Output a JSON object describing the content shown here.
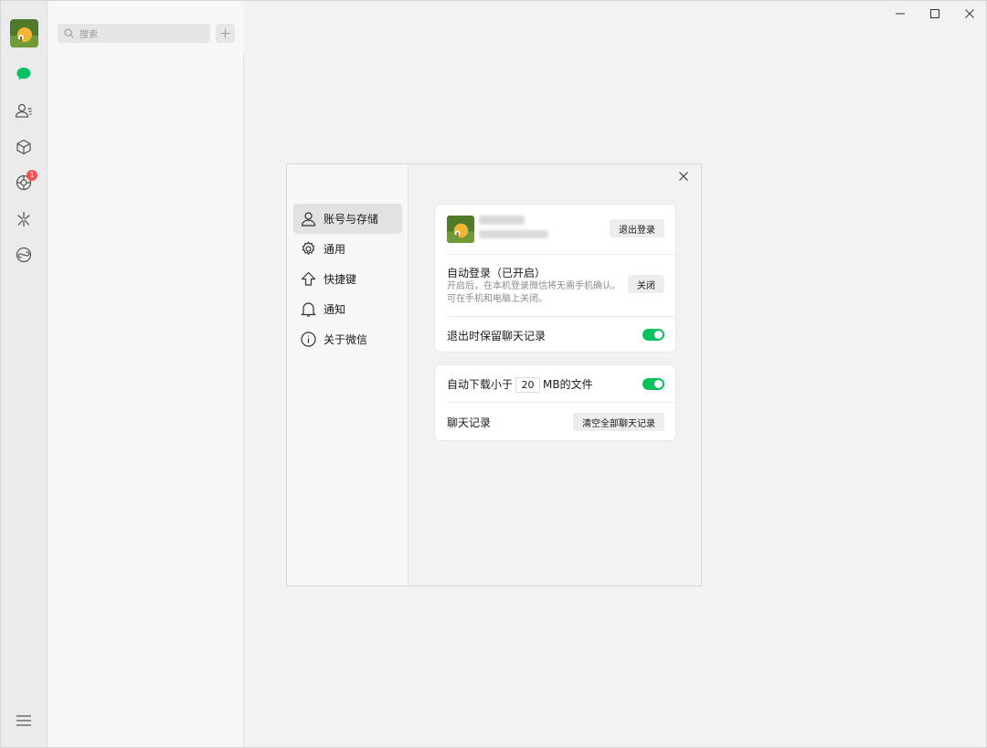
{
  "search": {
    "placeholder": "搜索"
  },
  "window_controls": [
    "minimize-icon",
    "maximize-icon",
    "close-icon"
  ],
  "rail": {
    "items": [
      {
        "name": "chat-icon",
        "active": true
      },
      {
        "name": "contacts-icon"
      },
      {
        "name": "favorites-icon"
      },
      {
        "name": "moments-icon",
        "badge": "1"
      },
      {
        "name": "channels-icon"
      },
      {
        "name": "mini-programs-icon"
      }
    ],
    "menu_icon": "menu-icon"
  },
  "settings": {
    "nav": [
      {
        "label": "账号与存储",
        "icon": "user-icon",
        "active": true
      },
      {
        "label": "通用",
        "icon": "gear-icon"
      },
      {
        "label": "快捷键",
        "icon": "shortcut-icon"
      },
      {
        "label": "通知",
        "icon": "bell-icon"
      },
      {
        "label": "关于微信",
        "icon": "info-icon"
      }
    ],
    "account": {
      "logout_button": "退出登录"
    },
    "auto_login": {
      "title": "自动登录（已开启）",
      "desc_line1": "开启后，在本机登录微信将无需手机确认。",
      "desc_line2": "可在手机和电脑上关闭。",
      "button": "关闭"
    },
    "keep_history": {
      "label": "退出时保留聊天记录",
      "enabled": true
    },
    "auto_download": {
      "prefix": "自动下载小于",
      "size": "20",
      "suffix": "MB的文件",
      "enabled": true
    },
    "chat_history": {
      "label": "聊天记录",
      "button": "清空全部聊天记录"
    }
  },
  "colors": {
    "accent": "#07c160",
    "badge": "#fa5151"
  }
}
